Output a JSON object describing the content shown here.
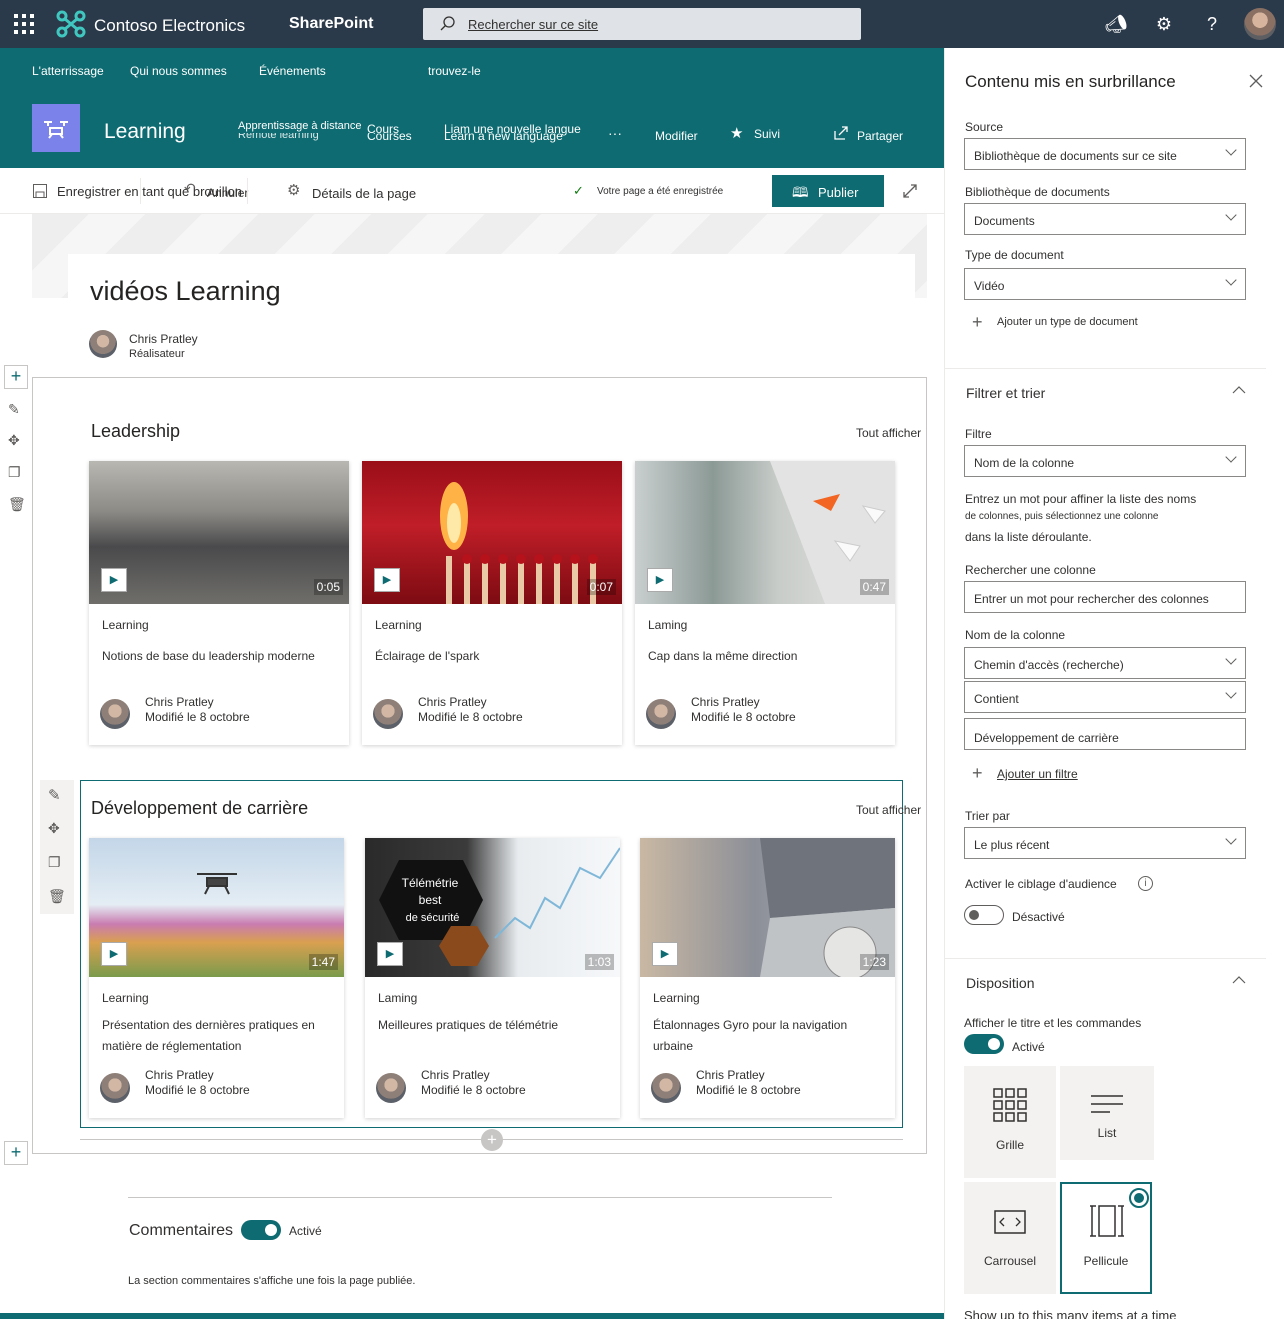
{
  "suitebar": {
    "brand": "Contoso Electronics",
    "app": "SharePoint",
    "search_placeholder": "Rechercher sur ce site"
  },
  "hubnav": {
    "items": [
      "L'atterrissage",
      "Qui nous sommes",
      "Événements",
      "trouvez-le"
    ]
  },
  "site": {
    "title": "Learning",
    "nav": [
      "Apprentissage à distance",
      "Remote learning",
      "Cours",
      "Courses",
      "Liam une nouvelle langue",
      "Learn a new language"
    ],
    "more": "···",
    "modify": "Modifier",
    "follow": "Suivi",
    "share": "Partager"
  },
  "cmdbar": {
    "save_draft": "Enregistrer en tant que brouillon",
    "undo": "Annuler",
    "page_details": "Détails de la page",
    "saved_status": "Votre page a été enregistrée",
    "publish": "Publier"
  },
  "page": {
    "title": "vidéos Learning",
    "author_name": "Chris Pratley",
    "author_role": "Réalisateur"
  },
  "sections": [
    {
      "heading": "Leadership",
      "see_all": "Tout afficher",
      "cards": [
        {
          "category": "Learning",
          "title": "Notions de base du leadership moderne",
          "duration": "0:05",
          "author": "Chris Pratley",
          "date": "Modifié le 8 octobre"
        },
        {
          "category": "Learning",
          "title": "Éclairage de l'spark",
          "duration": "0:07",
          "author": "Chris Pratley",
          "date": "Modifié le 8 octobre"
        },
        {
          "category": "Laming",
          "title": "Cap dans la même direction",
          "duration": "0:47",
          "author": "Chris Pratley",
          "date": "Modifié le 8 octobre"
        }
      ]
    },
    {
      "heading": "Développement de carrière",
      "see_all": "Tout afficher",
      "cards": [
        {
          "category": "Learning",
          "title": "Présentation des dernières pratiques en matière de réglementation",
          "duration": "1:47",
          "author": "Chris Pratley",
          "date": "Modifié le 8 octobre"
        },
        {
          "category": "Laming",
          "title": "Meilleures pratiques de télémétrie",
          "duration": "1:03",
          "author": "Chris Pratley",
          "date": "Modifié le 8 octobre",
          "overlay": [
            "Télémétrie",
            "best",
            "de sécurité"
          ]
        },
        {
          "category": "Learning",
          "title": "Étalonnages Gyro pour la navigation urbaine",
          "duration": "1:23",
          "author": "Chris Pratley",
          "date": "Modifié le 8 octobre"
        }
      ]
    }
  ],
  "comments": {
    "label": "Commentaires",
    "toggle": "Activé",
    "note": "La section commentaires s'affiche une fois la page publiée."
  },
  "panel": {
    "title": "Contenu mis en surbrillance",
    "source_label": "Source",
    "source_value": "Bibliothèque de documents sur ce site",
    "library_label": "Bibliothèque de documents",
    "library_value": "Documents",
    "doctype_label": "Type de document",
    "doctype_value": "Vidéo",
    "add_doctype": "Ajouter un type de document",
    "filter_section": "Filtrer et trier",
    "filter_label": "Filtre",
    "filter_value": "Nom de la colonne",
    "filter_help_1": "Entrez un mot pour affiner la liste des noms",
    "filter_help_2": "de colonnes, puis sélectionnez une colonne",
    "filter_help_3": "dans la liste déroulante.",
    "search_col_label": "Rechercher une colonne",
    "search_col_placeholder": "Entrer un mot pour rechercher des colonnes",
    "colname_label": "Nom de la colonne",
    "colname_value": "Chemin d'accès (recherche)",
    "operator_value": "Contient",
    "filter_text": "Développement de carrière",
    "add_filter": "Ajouter un filtre",
    "sort_label": "Trier par",
    "sort_value": "Le plus récent",
    "audience_label": "Activer le ciblage d'audience",
    "audience_state": "Désactivé",
    "layout_section": "Disposition",
    "show_title_label": "Afficher le titre et les commandes",
    "show_title_state": "Activé",
    "layouts": [
      "Grille",
      "List",
      "Carrousel",
      "Pellicule"
    ],
    "show_items": "Show up to this many items at a time"
  }
}
